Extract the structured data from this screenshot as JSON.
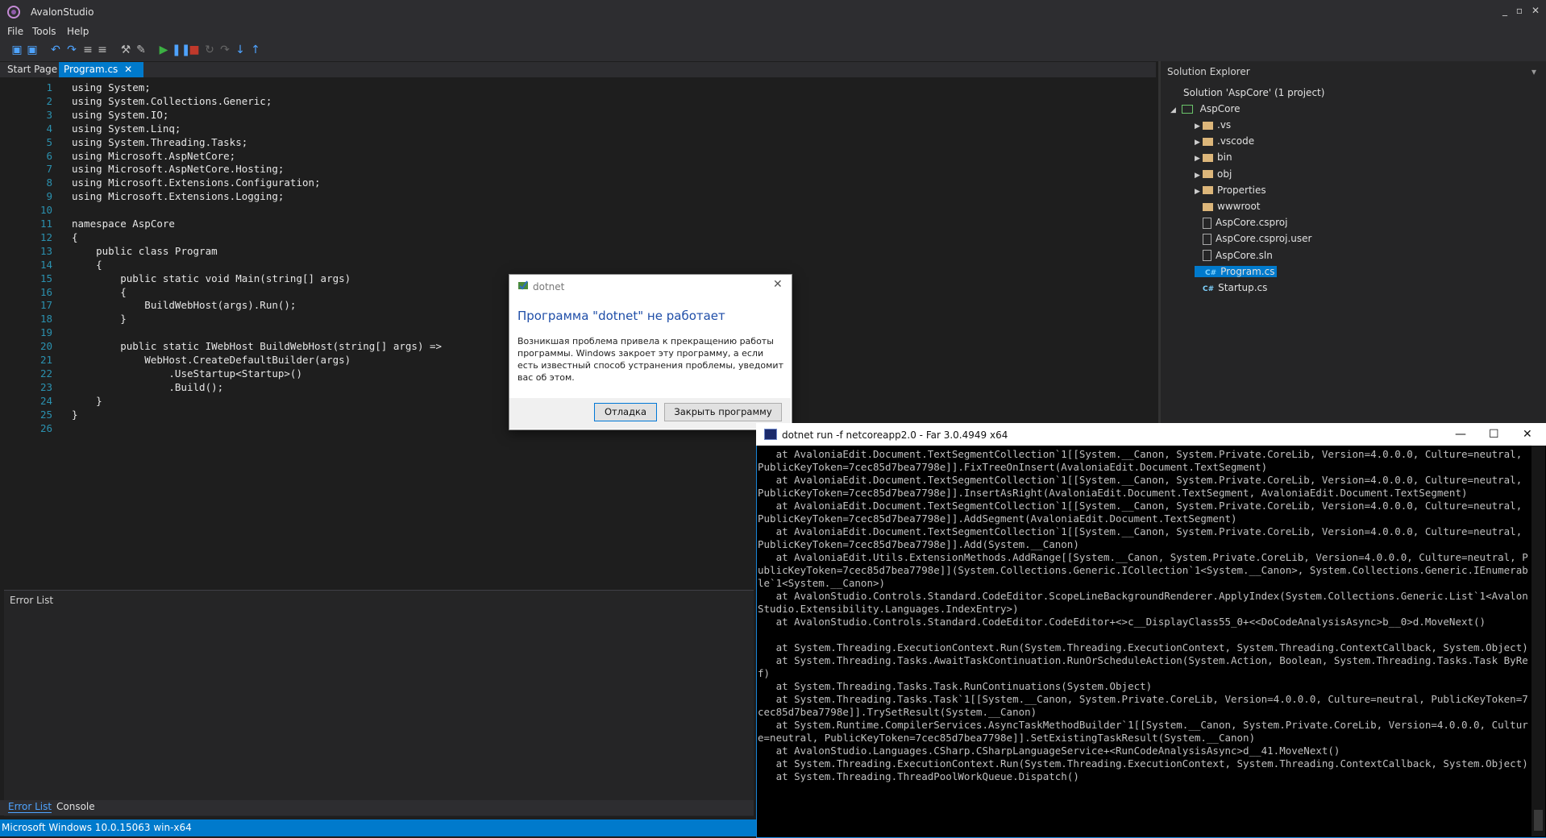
{
  "app": {
    "title": "AvalonStudio",
    "win_min": "_",
    "win_max": "▫",
    "win_close": "✕"
  },
  "menu": [
    "File",
    "Tools",
    "Help"
  ],
  "tabs": {
    "start_page": "Start Page",
    "program": "Program.cs",
    "close_glyph": "✕",
    "pin_glyph": "▾"
  },
  "editor": {
    "lines": [
      "using System;",
      "using System.Collections.Generic;",
      "using System.IO;",
      "using System.Linq;",
      "using System.Threading.Tasks;",
      "using Microsoft.AspNetCore;",
      "using Microsoft.AspNetCore.Hosting;",
      "using Microsoft.Extensions.Configuration;",
      "using Microsoft.Extensions.Logging;",
      "",
      "namespace AspCore",
      "{",
      "    public class Program",
      "    {",
      "        public static void Main(string[] args)",
      "        {",
      "            BuildWebHost(args).Run();",
      "        }",
      "",
      "        public static IWebHost BuildWebHost(string[] args) =>",
      "            WebHost.CreateDefaultBuilder(args)",
      "                .UseStartup<Startup>()",
      "                .Build();",
      "    }",
      "}",
      ""
    ]
  },
  "error_list": {
    "title": "Error List",
    "tab_error_list": "Error List",
    "tab_console": "Console"
  },
  "status": {
    "text": "Microsoft Windows 10.0.15063  win-x64"
  },
  "solution_explorer": {
    "title": "Solution Explorer",
    "solution": "Solution 'AspCore' (1 project)",
    "project": "AspCore",
    "items": [
      {
        "label": ".vs",
        "kind": "folder",
        "expandable": true
      },
      {
        "label": ".vscode",
        "kind": "folder",
        "expandable": true
      },
      {
        "label": "bin",
        "kind": "folder",
        "expandable": true
      },
      {
        "label": "obj",
        "kind": "folder",
        "expandable": true
      },
      {
        "label": "Properties",
        "kind": "folder",
        "expandable": true
      },
      {
        "label": "wwwroot",
        "kind": "folder",
        "expandable": false
      },
      {
        "label": "AspCore.csproj",
        "kind": "file",
        "expandable": false
      },
      {
        "label": "AspCore.csproj.user",
        "kind": "file",
        "expandable": false
      },
      {
        "label": "AspCore.sln",
        "kind": "file",
        "expandable": false
      },
      {
        "label": "Program.cs",
        "kind": "cs",
        "expandable": false,
        "selected": true
      },
      {
        "label": "Startup.cs",
        "kind": "cs",
        "expandable": false
      }
    ]
  },
  "dialog": {
    "caption": "dotnet",
    "heading": "Программа \"dotnet\" не работает",
    "message": "Возникшая проблема привела к прекращению работы программы. Windows закроет эту программу, а если есть известный способ устранения проблемы, уведомит вас об этом.",
    "btn_debug": "Отладка",
    "btn_close": "Закрыть программу"
  },
  "console": {
    "title": "dotnet run -f netcoreapp2.0 - Far 3.0.4949 x64",
    "text": "   at AvaloniaEdit.Document.TextSegmentCollection`1[[System.__Canon, System.Private.CoreLib, Version=4.0.0.0, Culture=neutral, PublicKeyToken=7cec85d7bea7798e]].FixTreeOnInsert(AvaloniaEdit.Document.TextSegment)\n   at AvaloniaEdit.Document.TextSegmentCollection`1[[System.__Canon, System.Private.CoreLib, Version=4.0.0.0, Culture=neutral, PublicKeyToken=7cec85d7bea7798e]].InsertAsRight(AvaloniaEdit.Document.TextSegment, AvaloniaEdit.Document.TextSegment)\n   at AvaloniaEdit.Document.TextSegmentCollection`1[[System.__Canon, System.Private.CoreLib, Version=4.0.0.0, Culture=neutral, PublicKeyToken=7cec85d7bea7798e]].AddSegment(AvaloniaEdit.Document.TextSegment)\n   at AvaloniaEdit.Document.TextSegmentCollection`1[[System.__Canon, System.Private.CoreLib, Version=4.0.0.0, Culture=neutral, PublicKeyToken=7cec85d7bea7798e]].Add(System.__Canon)\n   at AvaloniaEdit.Utils.ExtensionMethods.AddRange[[System.__Canon, System.Private.CoreLib, Version=4.0.0.0, Culture=neutral, PublicKeyToken=7cec85d7bea7798e]](System.Collections.Generic.ICollection`1<System.__Canon>, System.Collections.Generic.IEnumerable`1<System.__Canon>)\n   at AvalonStudio.Controls.Standard.CodeEditor.ScopeLineBackgroundRenderer.ApplyIndex(System.Collections.Generic.List`1<AvalonStudio.Extensibility.Languages.IndexEntry>)\n   at AvalonStudio.Controls.Standard.CodeEditor.CodeEditor+<>c__DisplayClass55_0+<<DoCodeAnalysisAsync>b__0>d.MoveNext()\n\n   at System.Threading.ExecutionContext.Run(System.Threading.ExecutionContext, System.Threading.ContextCallback, System.Object)\n   at System.Threading.Tasks.AwaitTaskContinuation.RunOrScheduleAction(System.Action, Boolean, System.Threading.Tasks.Task ByRef)\n   at System.Threading.Tasks.Task.RunContinuations(System.Object)\n   at System.Threading.Tasks.Task`1[[System.__Canon, System.Private.CoreLib, Version=4.0.0.0, Culture=neutral, PublicKeyToken=7cec85d7bea7798e]].TrySetResult(System.__Canon)\n   at System.Runtime.CompilerServices.AsyncTaskMethodBuilder`1[[System.__Canon, System.Private.CoreLib, Version=4.0.0.0, Culture=neutral, PublicKeyToken=7cec85d7bea7798e]].SetExistingTaskResult(System.__Canon)\n   at AvalonStudio.Languages.CSharp.CSharpLanguageService+<RunCodeAnalysisAsync>d__41.MoveNext()\n   at System.Threading.ExecutionContext.Run(System.Threading.ExecutionContext, System.Threading.ContextCallback, System.Object)\n   at System.Threading.ThreadPoolWorkQueue.Dispatch()"
  }
}
